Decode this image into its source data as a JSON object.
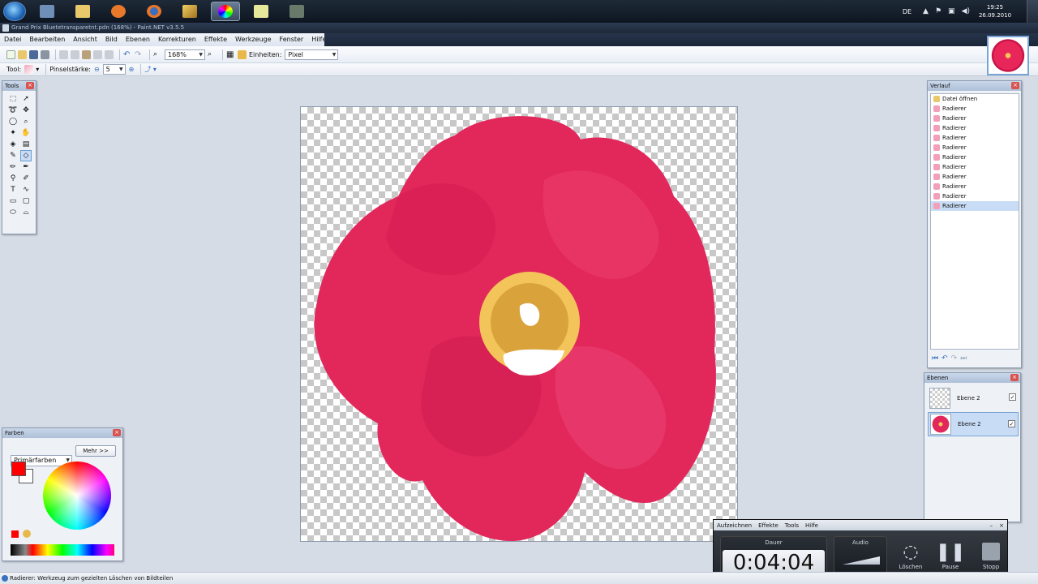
{
  "taskbar": {
    "apps": [
      "start-orb",
      "windows-explorer",
      "folder",
      "media-player",
      "firefox",
      "paint-net-tool",
      "color-app",
      "sticky-notes",
      "camtasia"
    ],
    "language": "DE",
    "clock_time": "19:25",
    "clock_date": "26.09.2010"
  },
  "window": {
    "title": "Grand Prix Bluetetransparetnt.pdn (168%) - Paint.NET v3.5.5"
  },
  "menu": [
    "Datei",
    "Bearbeiten",
    "Ansicht",
    "Bild",
    "Ebenen",
    "Korrekturen",
    "Effekte",
    "Werkzeuge",
    "Fenster",
    "Hilfe"
  ],
  "toolbar": {
    "zoom": "168%",
    "units_label": "Einheiten:",
    "units_value": "Pixel",
    "tool_label": "Tool:",
    "brush_label": "Pinselstärke:",
    "brush_value": "5"
  },
  "tools_panel": {
    "title": "Tools",
    "tools": [
      "rect-select",
      "move-selection",
      "lasso",
      "move-selected",
      "ellipse-select",
      "zoom",
      "magic-wand",
      "pan",
      "paint-bucket",
      "gradient",
      "paintbrush",
      "eraser",
      "pencil",
      "color-picker",
      "clone-stamp",
      "recolor",
      "text",
      "line-curve",
      "rectangle",
      "rounded-rect",
      "ellipse",
      "freeform"
    ]
  },
  "colors_panel": {
    "title": "Farben",
    "mode": "Primärfarben",
    "more_button": "Mehr >>",
    "primary_color": "#ff0000",
    "secondary_color": "#ffffff"
  },
  "history_panel": {
    "title": "Verlauf",
    "items": [
      "Datei öffnen",
      "Radierer",
      "Radierer",
      "Radierer",
      "Radierer",
      "Radierer",
      "Radierer",
      "Radierer",
      "Radierer",
      "Radierer",
      "Radierer",
      "Radierer"
    ]
  },
  "layers_panel": {
    "title": "Ebenen",
    "layers": [
      {
        "name": "Ebene 2",
        "visible_mark": "✓"
      },
      {
        "name": "Ebene 2",
        "visible_mark": "✓"
      }
    ]
  },
  "recorder": {
    "menu": [
      "Aufzeichnen",
      "Effekte",
      "Tools",
      "Hilfe"
    ],
    "duration_label": "Dauer",
    "time": "0:04:04",
    "audio_label": "Audio",
    "delete_label": "Löschen",
    "pause_label": "Pause",
    "stop_label": "Stopp"
  },
  "statusbar": {
    "text": "Radierer: Werkzeug zum gezielten Löschen von Bildteilen"
  },
  "colors": {
    "flower": "#e2275a",
    "accent": "#3a72c0"
  }
}
